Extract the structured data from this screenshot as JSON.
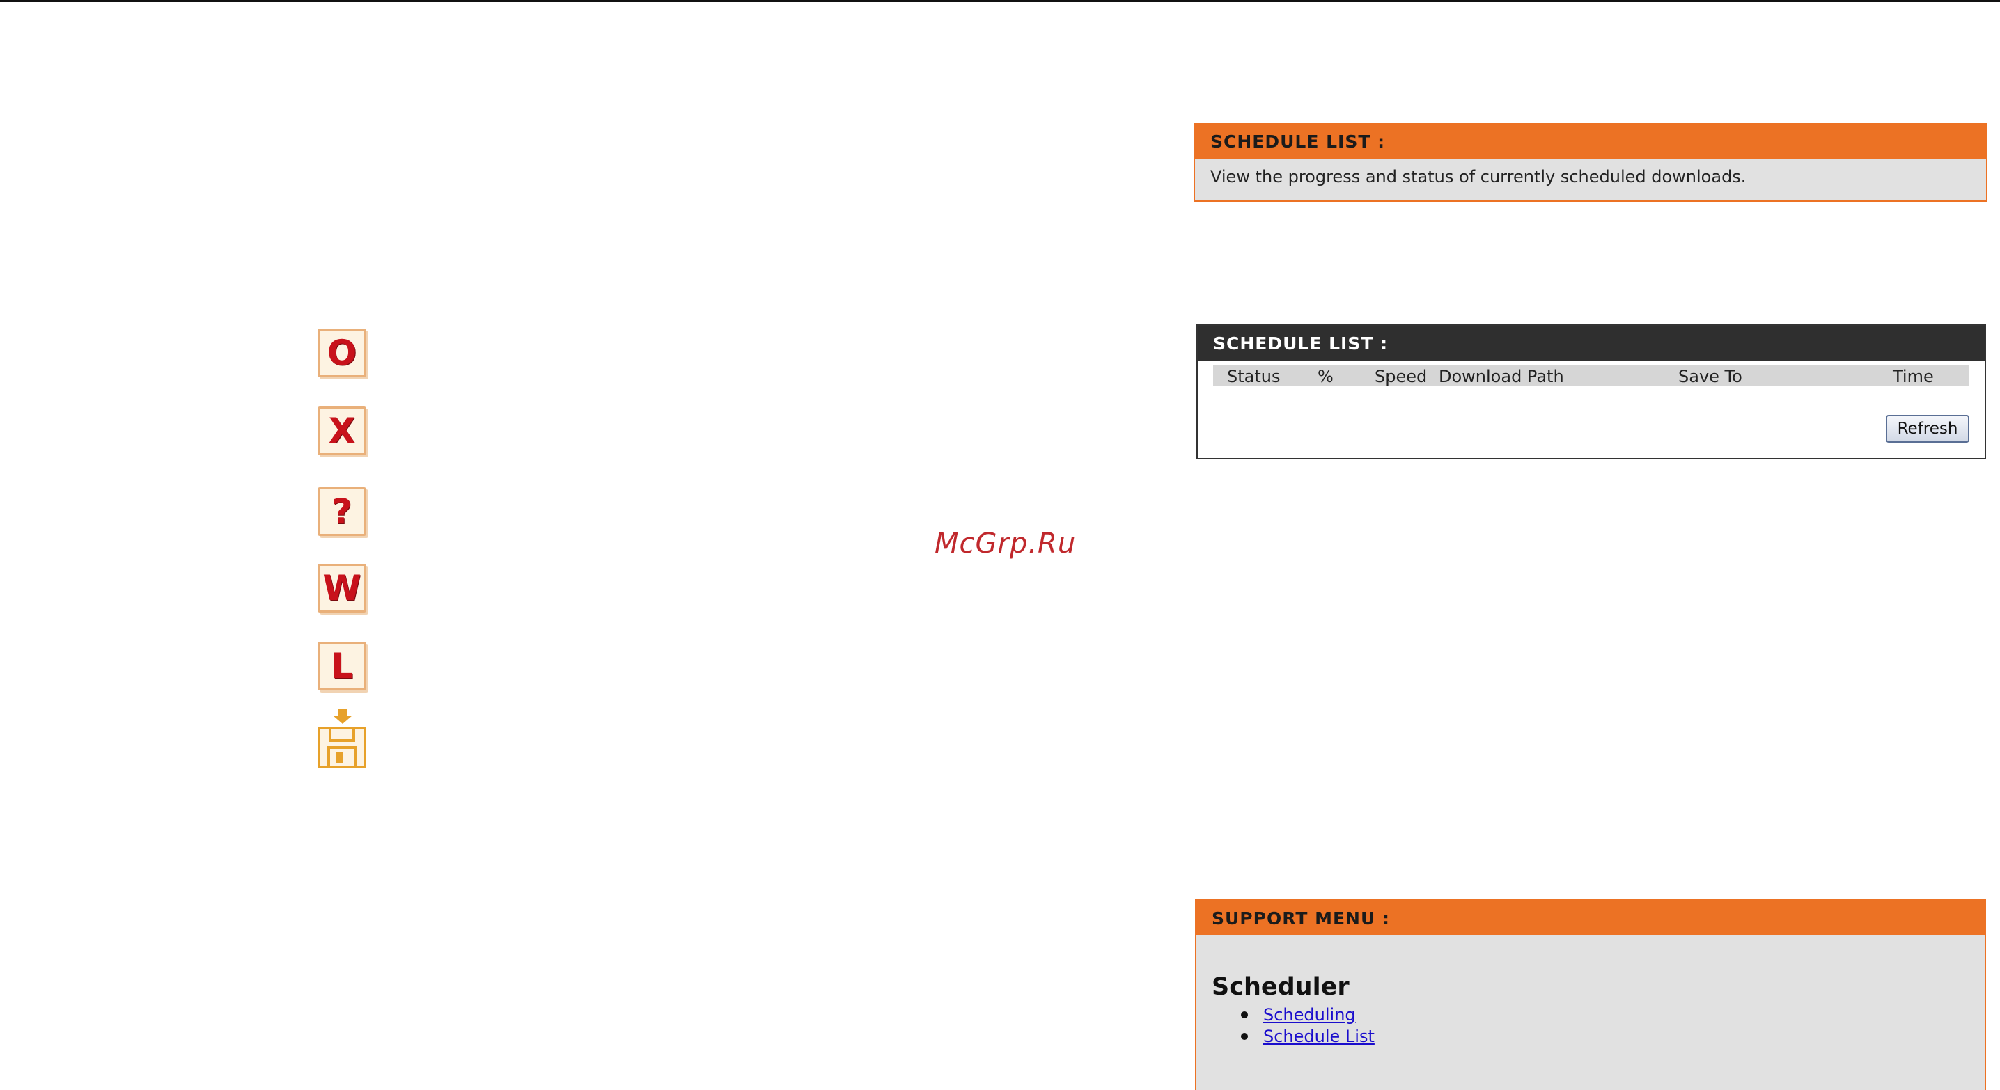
{
  "icons": [
    {
      "name": "o-icon",
      "glyph": "O"
    },
    {
      "name": "x-icon",
      "glyph": "X"
    },
    {
      "name": "question-icon",
      "glyph": "?"
    },
    {
      "name": "w-icon",
      "glyph": "W"
    },
    {
      "name": "l-icon",
      "glyph": "L"
    },
    {
      "name": "save-download-icon",
      "glyph": ""
    }
  ],
  "watermark": "McGrp.Ru",
  "schedule_info": {
    "title": "SCHEDULE LIST :",
    "description": "View the progress and status of currently scheduled downloads."
  },
  "schedule_table": {
    "title": "SCHEDULE LIST :",
    "columns": [
      "Status",
      "%",
      "Speed",
      "Download Path",
      "Save To",
      "Time"
    ],
    "rows": [],
    "refresh_label": "Refresh"
  },
  "support_menu": {
    "title": "SUPPORT MENU :",
    "section": "Scheduler",
    "links": [
      "Scheduling",
      "Schedule List"
    ]
  },
  "colors": {
    "accent_orange": "#ec7224",
    "dark_header": "#2f2f2f",
    "icon_red": "#c8121b",
    "link_blue": "#1a0dcc",
    "panel_gray": "#e1e1e1"
  }
}
